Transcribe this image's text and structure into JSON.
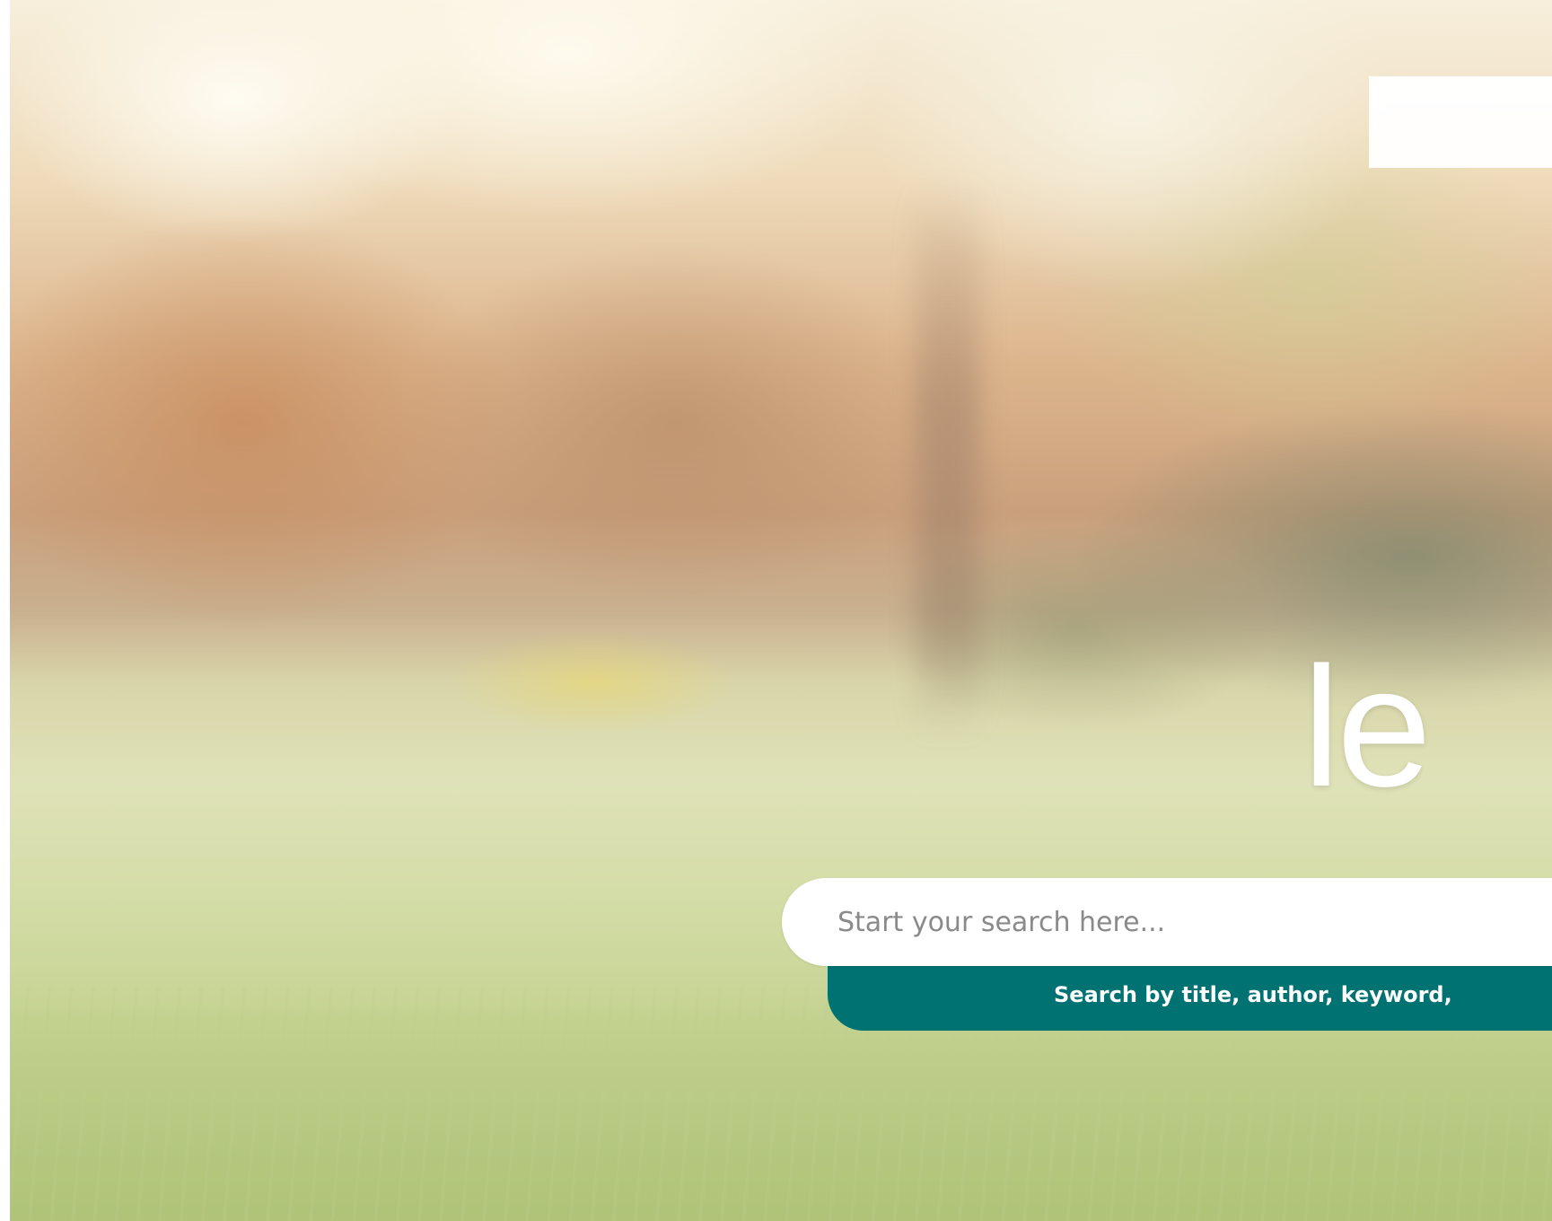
{
  "hero": {
    "headline": "le"
  },
  "search": {
    "placeholder": "Start your search here...",
    "hint": "Search by title, author, keyword,"
  },
  "colors": {
    "accent": "#007272",
    "input_background": "#ffffff"
  }
}
